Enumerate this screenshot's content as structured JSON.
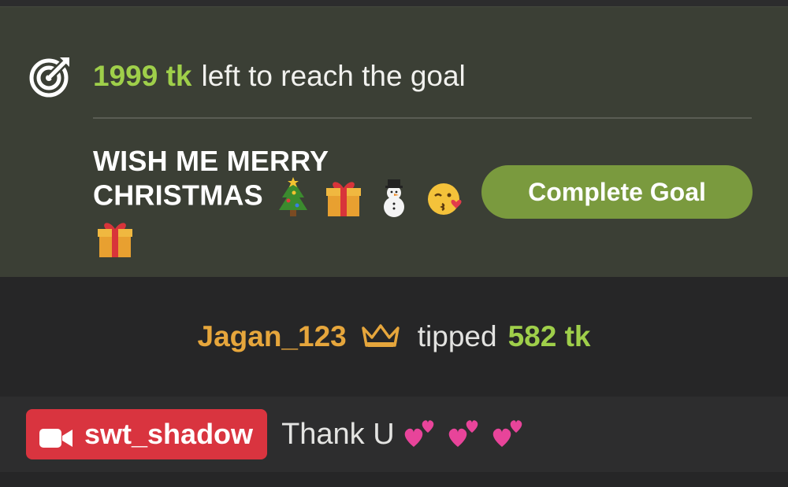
{
  "goal": {
    "amount": "1999 tk",
    "text": "left to reach the goal",
    "icon": "target-icon",
    "title": "WISH ME MERRY CHRISTMAS",
    "title_emojis": [
      "christmas-tree",
      "gift",
      "snowman",
      "kissing-face",
      "gift"
    ],
    "complete_label": "Complete Goal",
    "accent_color": "#9fcf4a",
    "button_color": "#7a9a3e"
  },
  "tip": {
    "user": "Jagan_123",
    "user_icon": "crown-icon",
    "verb": "tipped",
    "amount": "582 tk",
    "user_color": "#e6a63c"
  },
  "chat": {
    "username": "swt_shadow",
    "badge_icon": "video-camera-icon",
    "badge_color": "#d9343f",
    "message": "Thank U",
    "message_emojis": [
      "two-hearts",
      "two-hearts",
      "two-hearts"
    ]
  }
}
